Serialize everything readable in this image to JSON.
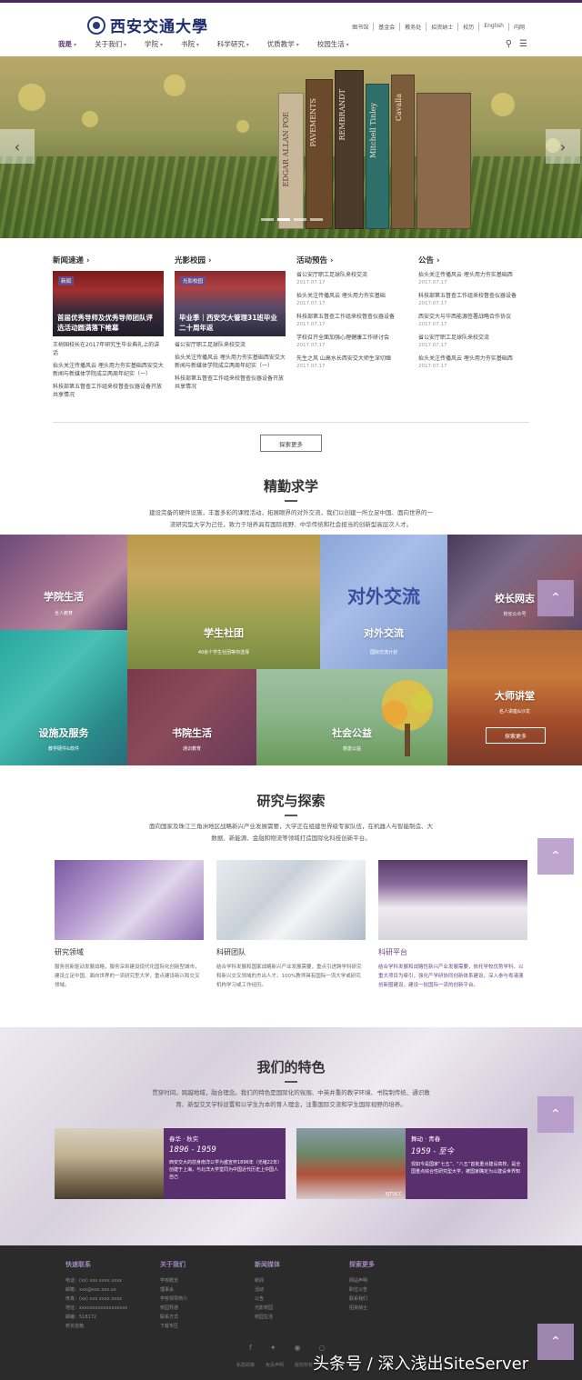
{
  "header": {
    "logo_text": "西安交通大學",
    "top_links": [
      "图书馆",
      "基金会",
      "教务处",
      "招资纳士",
      "校历",
      "English",
      "内网"
    ],
    "nav": [
      "我是",
      "关于我们",
      "学院",
      "书院",
      "科学研究",
      "优质教学",
      "校园生活"
    ]
  },
  "banner": {
    "book_titles": [
      "EDGAR ALLAN POE",
      "PAVEMENTS",
      "REMBRANDT",
      "Mitchell Tinley",
      "Cavalla"
    ],
    "dots_count": 4,
    "active_dot": 2
  },
  "news": {
    "col1": {
      "title": "新闻速递",
      "tag": "新闻",
      "caption": "首届优秀导师及优秀导师团队评选活动圆满落下帷幕",
      "items": [
        "王树国校长在2017年研究生毕业典礼上的讲话",
        "抬头关注传播风云 埋头用力夯实基础西安交大新闻与新媒体学院成立两周年纪实（一）",
        "科技部第五督查工作组来校督查仪器设备开放共享情况"
      ]
    },
    "col2": {
      "title": "光影校园",
      "tag": "光影校园",
      "caption": "毕业季｜西安交大管理31班毕业二十周年返",
      "items": [
        "省公安厅职工足球队来校交流",
        "抬头关注传播风云 埋头用力夯实基础西安交大新闻与新媒体学院成立两周年纪实（一）",
        "科技部第五督查工作组来校督查仪器设备开放共享情况"
      ]
    },
    "col3": {
      "title": "活动预告",
      "items": [
        {
          "t": "省公安厅职工足球队来校交流",
          "d": "2017.07.17"
        },
        {
          "t": "抬头关注传播风云 埋头用力夯实基础",
          "d": "2017.07.17"
        },
        {
          "t": "科技部第五督查工作组来校督查仪器设备",
          "d": "2017.07.17"
        },
        {
          "t": "学校召开全面加强心理健康工作研讨会",
          "d": "2017.07.17"
        },
        {
          "t": "先生之风 山高水长西安交大师生深切缅",
          "d": "2017.07.17"
        }
      ]
    },
    "col4": {
      "title": "公告",
      "items": [
        {
          "t": "抬头关注传播风云 埋头用力夯实基础西",
          "d": "2017.07.17"
        },
        {
          "t": "科技部第五督查工作组来校督查仪器设备",
          "d": "2017.07.17"
        },
        {
          "t": "西安交大与华西能源签署战略合作协议",
          "d": "2017.07.17"
        },
        {
          "t": "省公安厅职工足球队来校交流",
          "d": "2017.07.17"
        },
        {
          "t": "抬头关注传播风云 埋头用力夯实基础西",
          "d": "2017.07.17"
        }
      ]
    },
    "more_label": "探索更多"
  },
  "study": {
    "title": "精勤求学",
    "desc1": "建设完备的硬件设施，丰富多彩的课程活动，拓展眼界的对外交流，我们以创建一所立足中国、面向世界的一",
    "desc2": "流研究型大学为己任，致力于培养具有国际视野、中华传统和社会担当的创新型高层次人才。",
    "tiles": [
      {
        "title": "学院生活",
        "sub": "全人教育"
      },
      {
        "title": "学生社团",
        "sub": "40余个学生社团等你选择"
      },
      {
        "title": "对外交流",
        "sub": "国际交流计划"
      },
      {
        "title": "校长网志",
        "sub": "校长公众号"
      },
      {
        "title": "设施及服务",
        "sub": "教学硬件&软件"
      },
      {
        "title": "书院生活",
        "sub": "通识教育"
      },
      {
        "title": "社会公益",
        "sub": "慈善公益"
      },
      {
        "title": "大师讲堂",
        "sub": "名人讲座&沙龙"
      }
    ],
    "exchange_art_text": "对外交流",
    "tile_more_label": "探索更多"
  },
  "research": {
    "title": "研究与探索",
    "desc1": "面向国家及珠江三角洲地区战略新兴产业发展需要，大学正在组建世界级专家队伍，在机器人与智能制造、大",
    "desc2": "数据、新能源、金融和物流等领域打造国际化科技创新平台。",
    "cards": [
      {
        "title": "研究领域",
        "text": "服务创新驱动发展战略，服务深圳建设现代化国际化创新型城市，建设立足中国、面向世界的一流研究型大学，重点建设新兴和交叉领域。"
      },
      {
        "title": "科研团队",
        "text": "结合学科发展和国家战略新兴产业发展需要，重点引进跨学科研究和新兴交叉领域的杰出人才。100%教师具有国际一流大学或研究机构学习或工作经历。"
      },
      {
        "title": "科研平台",
        "text": "结合学科发展和战略性新兴产业发展需要，依托学校优势学科，以重大项目为牵引，强化产学研协同创新体系建设，深入参与粤港澳创新圈建设，建设一批国际一流的创新平台。"
      }
    ]
  },
  "features": {
    "title": "我们的特色",
    "desc1": "贯穿时间，跨越地域，融合理念。我们的特色是国际化的氛围、中英并重的教学环境、书院制传统、通识教",
    "desc2": "育、新型交叉学科设置和以学生为本的育人理念，注重国际交流和学生国际视野的培养。",
    "cards": [
      {
        "a": "春华 · 秋实",
        "b": "1896 - 1959",
        "c": "西安交大的前身南洋公学为盛宣怀1896年（光绪22年）创建于上海，与北洋大学堂同为中国近代历史上中国人自己"
      },
      {
        "a": "舞动 · 青春",
        "b": "1959 - 至今",
        "c": "现如今是国家“七五”、“八五”首批重点建设高校，是全国重点综合性研究型大学，被国家确定为以建设世界知"
      }
    ],
    "photo_label": "XJTUCC"
  },
  "footer": {
    "cols": [
      {
        "title": "快速联系",
        "items": [
          "电话：(xx) xxx xxxx xxxx",
          "邮箱：xxx@xxx.xxx.xx",
          "传真：(xx) xxx xxxx xxxx",
          "地址：xxxxxxxxxxxxxxxxxx",
          "邮编：518172",
          "校长信箱"
        ]
      },
      {
        "title": "关于我们",
        "items": [
          "学校概览",
          "理事会",
          "学校领导简介",
          "校园导游",
          "联系方式",
          "下载专区"
        ]
      },
      {
        "title": "新闻媒体",
        "items": [
          "新闻",
          "活动",
          "公告",
          "光影校园",
          "校园生活"
        ]
      },
      {
        "title": "探索更多",
        "items": [
          "网站声明",
          "职位公告",
          "联系我们",
          "招资纳士"
        ]
      }
    ],
    "social_icons": [
      "facebook-icon",
      "twitter-icon",
      "weibo-icon",
      "wechat-icon"
    ],
    "links": [
      "私隐政策",
      "免责声明",
      "版权所有"
    ]
  },
  "watermark": "头条号 / 深入浅出SiteServer",
  "colors": {
    "brand": "#5d3b7a",
    "footer_bg": "#2b2b2b",
    "card_bg": "#5a2f6e",
    "scroll_btn": "#b496c8"
  }
}
